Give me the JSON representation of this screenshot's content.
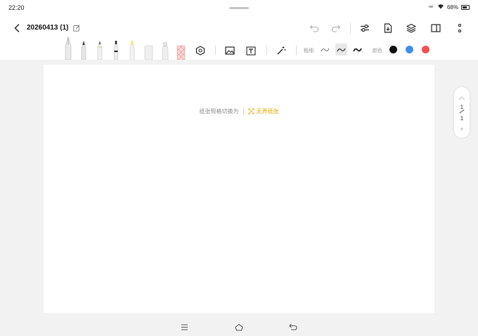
{
  "status": {
    "time": "22:20",
    "signal_label": "HD",
    "battery_percent": "68%",
    "battery_level": 0.68
  },
  "header": {
    "title": "20260413 (1)",
    "icons": [
      "back-icon",
      "edit-icon",
      "undo-icon",
      "redo-icon",
      "adjust-icon",
      "export-icon",
      "layers-icon",
      "book-icon",
      "more-icon"
    ]
  },
  "toolbar": {
    "tools": [
      "fountain-pen",
      "ink-pen",
      "pencil",
      "marker",
      "highlighter",
      "eraser",
      "spray",
      "pattern-brush"
    ],
    "thickness_label": "粗细",
    "color_label": "颜色",
    "selected_thickness_index": 1,
    "colors": [
      "#111111",
      "#3d8fe8",
      "#ef5350"
    ]
  },
  "canvas": {
    "hint_text": "纸张规格切换为",
    "hint_link": "无界纸张",
    "accent_color": "#e0a800"
  },
  "page_nav": {
    "current": "1",
    "total": "1",
    "add_label": "+"
  }
}
